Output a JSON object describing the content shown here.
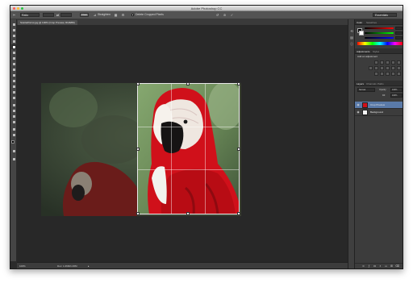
{
  "window": {
    "title": "Adobe Photoshop CC"
  },
  "options_bar": {
    "ratio_label": "Ratio",
    "straighten_label": "Straighten",
    "clear_label": "Clear",
    "delete_cropped_label": "Delete Cropped Pixels",
    "workspace": "Essentials"
  },
  "document": {
    "tab_label": "ScarletParrot.jpg @ 100% (Crop Preview, RGB/8#)",
    "zoom": "100%",
    "doc_info": "Doc: 1.06M/1.06M"
  },
  "panels": {
    "color_tabs": [
      "Color",
      "Swatches"
    ],
    "adjustments_tabs": [
      "Adjustments",
      "Styles"
    ],
    "adjustments_heading": "Add an adjustment",
    "layers_tabs": [
      "Layers",
      "Channels",
      "Paths"
    ],
    "blend_mode": "Normal",
    "opacity_label": "Opacity:",
    "opacity_value": "100%",
    "fill_label": "Fill:",
    "fill_value": "100%",
    "layers": [
      {
        "name": "Crop Preview",
        "selected": true
      },
      {
        "name": "Background",
        "selected": false
      }
    ]
  },
  "colors": {
    "ui_dark": "#282828",
    "panel": "#3c3c3c",
    "selection": "#5a7aa8",
    "parrot_red": "#d0101a"
  }
}
